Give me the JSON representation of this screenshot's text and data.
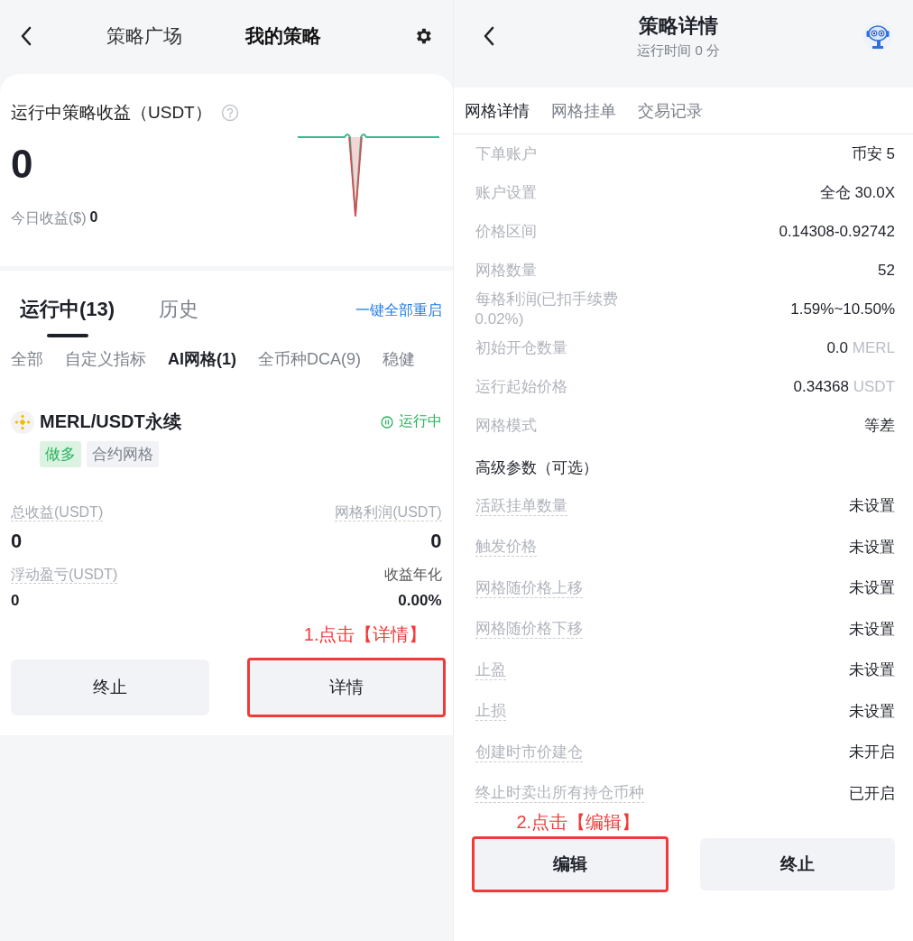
{
  "left": {
    "header_tabs": [
      {
        "label": "策略广场",
        "selected": false
      },
      {
        "label": "我的策略",
        "selected": true
      }
    ],
    "summary": {
      "title": "运行中策略收益（USDT）",
      "total": "0",
      "today_label": "今日收益($)",
      "today_value": "0"
    },
    "tabs": [
      {
        "label": "运行中(13)",
        "selected": true
      },
      {
        "label": "历史",
        "selected": false
      }
    ],
    "restart_link": "一键全部重启",
    "filters": [
      {
        "label": "全部",
        "selected": false
      },
      {
        "label": "自定义指标",
        "selected": false
      },
      {
        "label": "AI网格(1)",
        "selected": true
      },
      {
        "label": "全币种DCA(9)",
        "selected": false
      },
      {
        "label": "稳健",
        "selected": false
      }
    ],
    "strategy": {
      "pair": "MERL/USDT永续",
      "status": "运行中",
      "tags": [
        {
          "label": "做多",
          "kind": "direction"
        },
        {
          "label": "合约网格",
          "kind": "type"
        }
      ],
      "stats": [
        {
          "label": "总收益(USDT)",
          "value": "0",
          "dashed": true
        },
        {
          "label": "网格利润(USDT)",
          "value": "0",
          "dashed": true
        },
        {
          "label": "浮动盈亏(USDT)",
          "value": "0",
          "dashed": true
        },
        {
          "label": "收益年化",
          "value": "0.00%",
          "dashed": false
        }
      ]
    },
    "annotation": "1.点击【详情】",
    "buttons": [
      {
        "label": "终止",
        "highlighted": false
      },
      {
        "label": "详情",
        "highlighted": true
      }
    ]
  },
  "right": {
    "title": "策略详情",
    "subtitle": "运行时间 0 分",
    "tabs": [
      {
        "label": "网格详情",
        "selected": true
      },
      {
        "label": "网格挂单",
        "selected": false
      },
      {
        "label": "交易记录",
        "selected": false
      }
    ],
    "rows": [
      {
        "label": "下单账户",
        "value": "币安 5"
      },
      {
        "label": "账户设置",
        "value": "全仓 30.0X"
      },
      {
        "label": "价格区间",
        "value": "0.14308-0.92742"
      },
      {
        "label": "网格数量",
        "value": "52"
      },
      {
        "label": "每格利润(已扣手续费 0.02%)",
        "value": "1.59%~10.50%"
      },
      {
        "label": "初始开仓数量",
        "value": "0.0",
        "unit": "MERL"
      },
      {
        "label": "运行起始价格",
        "value": "0.34368",
        "unit": "USDT"
      },
      {
        "label": "网格模式",
        "value": "等差"
      }
    ],
    "advanced_title": "高级参数（可选）",
    "advanced_rows": [
      {
        "label": "活跃挂单数量",
        "value": "未设置",
        "dashed": true
      },
      {
        "label": "触发价格",
        "value": "未设置",
        "dashed": true
      },
      {
        "label": "网格随价格上移",
        "value": "未设置",
        "dashed": true
      },
      {
        "label": "网格随价格下移",
        "value": "未设置",
        "dashed": true
      },
      {
        "label": "止盈",
        "value": "未设置",
        "dashed": true
      },
      {
        "label": "止损",
        "value": "未设置",
        "dashed": true
      },
      {
        "label": "创建时市价建仓",
        "value": "未开启",
        "dashed": true
      },
      {
        "label": "终止时卖出所有持仓币种",
        "value": "已开启",
        "dashed": true
      }
    ],
    "annotation": "2.点击【编辑】",
    "buttons": [
      {
        "label": "编辑",
        "highlighted": true
      },
      {
        "label": "终止",
        "highlighted": false
      }
    ]
  }
}
